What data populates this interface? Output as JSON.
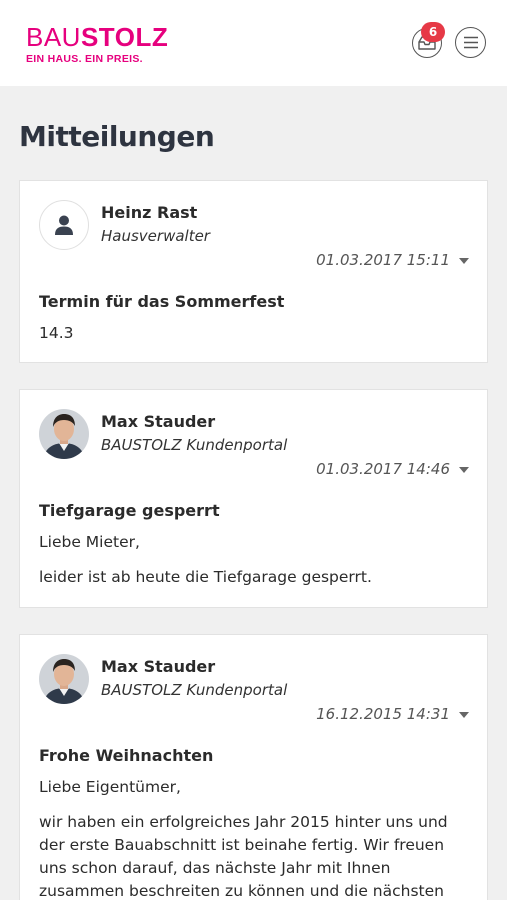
{
  "header": {
    "logo_light": "BAU",
    "logo_bold": "STOLZ",
    "logo_tagline": "EIN HAUS. EIN PREIS.",
    "inbox_badge": "6",
    "brand_color": "#e6007e",
    "badge_color": "#e63946"
  },
  "page_title": "Mitteilungen",
  "messages": [
    {
      "sender": "Heinz Rast",
      "role": "Hausverwalter",
      "date": "01.03.2017 15:11",
      "subject": "Termin für das Sommerfest",
      "body": [
        "14.3"
      ]
    },
    {
      "sender": "Max Stauder",
      "role": "BAUSTOLZ Kundenportal",
      "date": "01.03.2017 14:46",
      "subject": "Tiefgarage gesperrt",
      "body": [
        "Liebe Mieter,",
        "leider ist ab heute die Tiefgarage gesperrt."
      ]
    },
    {
      "sender": "Max Stauder",
      "role": "BAUSTOLZ Kundenportal",
      "date": "16.12.2015 14:31",
      "subject": "Frohe Weihnachten",
      "body": [
        "Liebe Eigentümer,",
        "wir haben ein erfolgreiches Jahr 2015 hinter uns und der erste Bauabschnitt ist beinahe fertig. Wir freuen uns schon darauf, das nächste Jahr mit Ihnen zusammen beschreiten zu können und die nächsten"
      ]
    }
  ]
}
